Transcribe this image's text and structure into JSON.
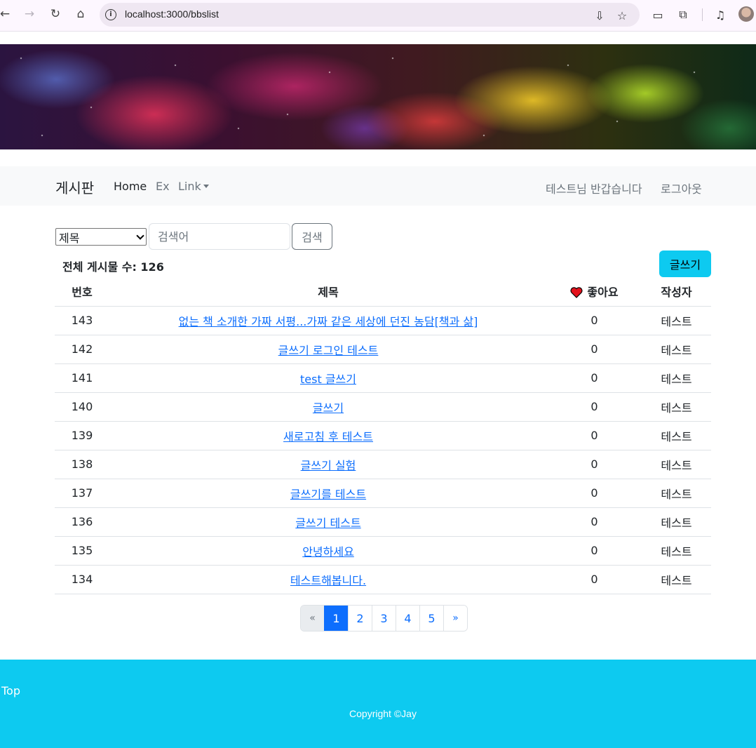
{
  "browser": {
    "url": "localhost:3000/bbslist"
  },
  "navbar": {
    "brand": "게시판",
    "links": [
      {
        "label": "Home"
      },
      {
        "label": "Ex"
      },
      {
        "label": "Link"
      }
    ],
    "greeting": "테스트님 반갑습니다",
    "logout": "로그아웃"
  },
  "search": {
    "select_value": "제목",
    "placeholder": "검색어",
    "button": "검색"
  },
  "board": {
    "total_label": "전체 게시물 수: 126",
    "write_button": "글쓰기",
    "columns": [
      "번호",
      "제목",
      "좋아요",
      "작성자"
    ],
    "rows": [
      {
        "no": "143",
        "title": "없는 책 소개한 가짜 서평...가짜 같은 세상에 던진 농담[책과 삶]",
        "likes": "0",
        "author": "테스트"
      },
      {
        "no": "142",
        "title": "글쓰기 로그인 테스트",
        "likes": "0",
        "author": "테스트"
      },
      {
        "no": "141",
        "title": "test 글쓰기",
        "likes": "0",
        "author": "테스트"
      },
      {
        "no": "140",
        "title": "글쓰기",
        "likes": "0",
        "author": "테스트"
      },
      {
        "no": "139",
        "title": "새로고침 후 테스트",
        "likes": "0",
        "author": "테스트"
      },
      {
        "no": "138",
        "title": "글쓰기 실험",
        "likes": "0",
        "author": "테스트"
      },
      {
        "no": "137",
        "title": "글쓰기를 테스트",
        "likes": "0",
        "author": "테스트"
      },
      {
        "no": "136",
        "title": "글쓰기 테스트 ",
        "likes": "0",
        "author": "테스트"
      },
      {
        "no": "135",
        "title": "안녕하세요 ",
        "likes": "0",
        "author": "테스트"
      },
      {
        "no": "134",
        "title": "테스트해봅니다.",
        "likes": "0",
        "author": "테스트"
      }
    ]
  },
  "pagination": {
    "prev": "«",
    "pages": [
      "1",
      "2",
      "3",
      "4",
      "5"
    ],
    "active": "1",
    "next": "»"
  },
  "footer": {
    "top": "Top",
    "copyright": "Copyright ©Jay"
  },
  "colors": {
    "accent": "#0dcaf0",
    "link": "#0d6efd",
    "heart": "#e3121c"
  }
}
